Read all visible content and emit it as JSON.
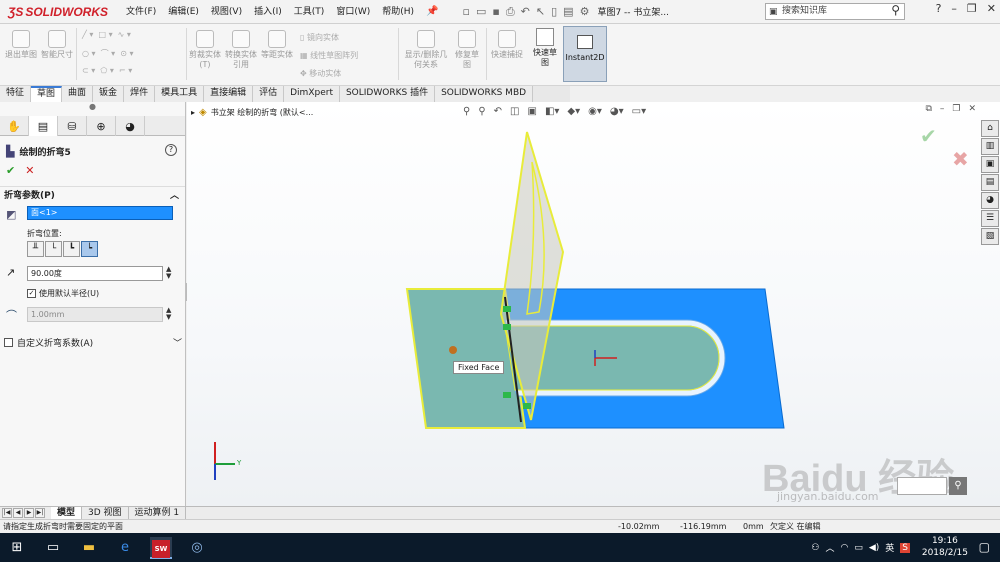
{
  "app": {
    "logo": "SOLIDWORKS",
    "menu": [
      "文件(F)",
      "编辑(E)",
      "视图(V)",
      "插入(I)",
      "工具(T)",
      "窗口(W)",
      "帮助(H)"
    ],
    "doc_title": "草图7 -- 书立架...",
    "search_placeholder": "搜索知识库",
    "help": "?"
  },
  "commands": {
    "exit_sketch": "退出草图",
    "smart_dim": "智能尺寸",
    "trim": "剪裁实体(T)",
    "convert": "转换实体引用",
    "offset": "等距实体",
    "mirror": "镜向实体",
    "linear_pattern": "线性草图阵列",
    "move": "移动实体",
    "relations": "显示/删除几何关系",
    "repair": "修复草图",
    "snap": "快速捕捉",
    "quick_sketch": "快速草图",
    "instant2d": "Instant2D"
  },
  "tabs": [
    {
      "label": "特征",
      "active": false
    },
    {
      "label": "草图",
      "active": true
    },
    {
      "label": "曲面",
      "active": false
    },
    {
      "label": "钣金",
      "active": false
    },
    {
      "label": "焊件",
      "active": false
    },
    {
      "label": "模具工具",
      "active": false
    },
    {
      "label": "直接编辑",
      "active": false
    },
    {
      "label": "评估",
      "active": false
    },
    {
      "label": "DimXpert",
      "active": false
    },
    {
      "label": "SOLIDWORKS 插件",
      "active": false
    },
    {
      "label": "SOLIDWORKS MBD",
      "active": false
    }
  ],
  "property_manager": {
    "title": "绘制的折弯5",
    "section_params": "折弯参数(P)",
    "face_value": "面<1>",
    "bend_position_label": "折弯位置:",
    "angle_value": "90.00度",
    "use_default_radius": "使用默认半径(U)",
    "radius_value": "1.00mm",
    "custom_allowance": "自定义折弯系数(A)"
  },
  "viewport": {
    "breadcrumb": "书立架 绘制的折弯 (默认<...",
    "tooltip": "Fixed Face",
    "axis_y": "Y",
    "watermark": "Baidu 经验",
    "watermark_url": "jingyan.baidu.com"
  },
  "bottom_tabs": [
    {
      "label": "模型",
      "active": true
    },
    {
      "label": "3D 视图",
      "active": false
    },
    {
      "label": "运动算例 1",
      "active": false
    }
  ],
  "status": {
    "message": "请指定生成折弯时需要固定的平面",
    "x": "-10.02mm",
    "y": "-116.19mm",
    "z": "0mm",
    "extra": "欠定义  在编辑"
  },
  "taskbar": {
    "sw_label": "SW",
    "tray_lang": "英",
    "time": "19:16",
    "date": "2018/2/15"
  },
  "colors": {
    "accent": "#1e90ff",
    "part_blue": "#1e90ff",
    "fixed_face": "#7ab8b0",
    "highlight": "#e8ec3a"
  }
}
